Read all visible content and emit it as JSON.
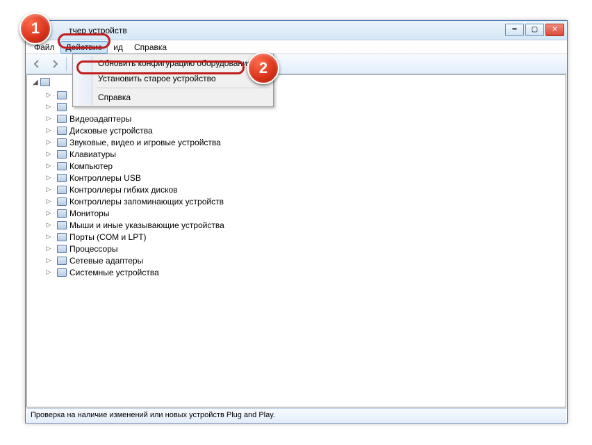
{
  "window": {
    "title": "тчер устройств"
  },
  "menu": {
    "file": "Файл",
    "action": "Действие",
    "view": "ид",
    "help": "Справка"
  },
  "dropdown": {
    "update": "Обновить конфигурацию оборудования",
    "legacy": "Установить старое устройство",
    "help": "Справка"
  },
  "tree": {
    "items": [
      {
        "label": "Видеоадаптеры"
      },
      {
        "label": "Дисковые устройства"
      },
      {
        "label": "Звуковые, видео и игровые устройства"
      },
      {
        "label": "Клавиатуры"
      },
      {
        "label": "Компьютер"
      },
      {
        "label": "Контроллеры USB"
      },
      {
        "label": "Контроллеры гибких дисков"
      },
      {
        "label": "Контроллеры запоминающих устройств"
      },
      {
        "label": "Мониторы"
      },
      {
        "label": "Мыши и иные указывающие устройства"
      },
      {
        "label": "Порты (COM и LPT)"
      },
      {
        "label": "Процессоры"
      },
      {
        "label": "Сетевые адаптеры"
      },
      {
        "label": "Системные устройства"
      }
    ]
  },
  "status": "Проверка на наличие изменений или новых устройств Plug and Play.",
  "badges": {
    "one": "1",
    "two": "2"
  }
}
